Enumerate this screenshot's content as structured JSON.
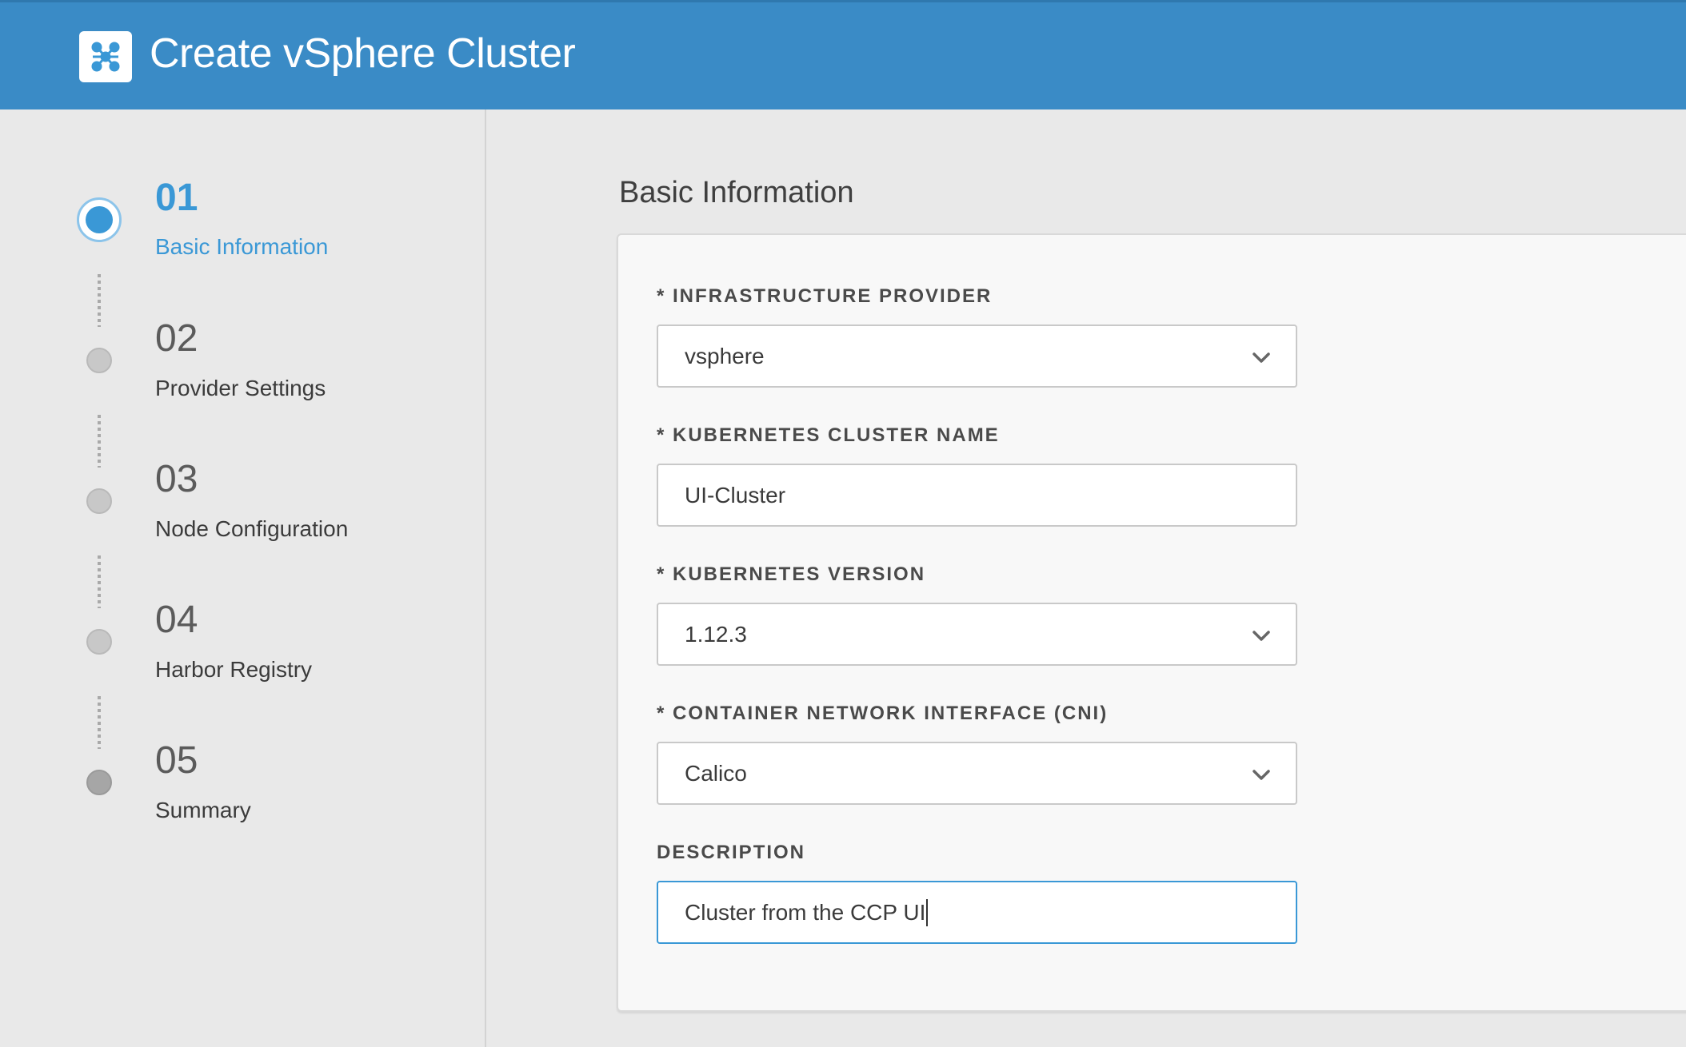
{
  "header": {
    "title": "Create vSphere Cluster",
    "logo_icon": "network-nodes-icon",
    "bg_color": "#3a8bc6"
  },
  "steps": [
    {
      "number": "01",
      "label": "Basic Information",
      "state": "active"
    },
    {
      "number": "02",
      "label": "Provider Settings",
      "state": "pending"
    },
    {
      "number": "03",
      "label": "Node Configuration",
      "state": "pending"
    },
    {
      "number": "04",
      "label": "Harbor Registry",
      "state": "pending"
    },
    {
      "number": "05",
      "label": "Summary",
      "state": "pending"
    }
  ],
  "form": {
    "title": "Basic Information",
    "fields": [
      {
        "label": "* INFRASTRUCTURE PROVIDER",
        "value": "vsphere",
        "type": "select"
      },
      {
        "label": "* KUBERNETES CLUSTER NAME",
        "value": "UI-Cluster",
        "type": "text"
      },
      {
        "label": "* KUBERNETES VERSION",
        "value": "1.12.3",
        "type": "select"
      },
      {
        "label": "* CONTAINER NETWORK INTERFACE (CNI)",
        "value": "Calico",
        "type": "select"
      },
      {
        "label": "DESCRIPTION",
        "value": "Cluster from the CCP UI",
        "type": "text",
        "focused": true
      }
    ]
  },
  "colors": {
    "accent": "#3a98d6",
    "background": "#e9e9e9"
  }
}
